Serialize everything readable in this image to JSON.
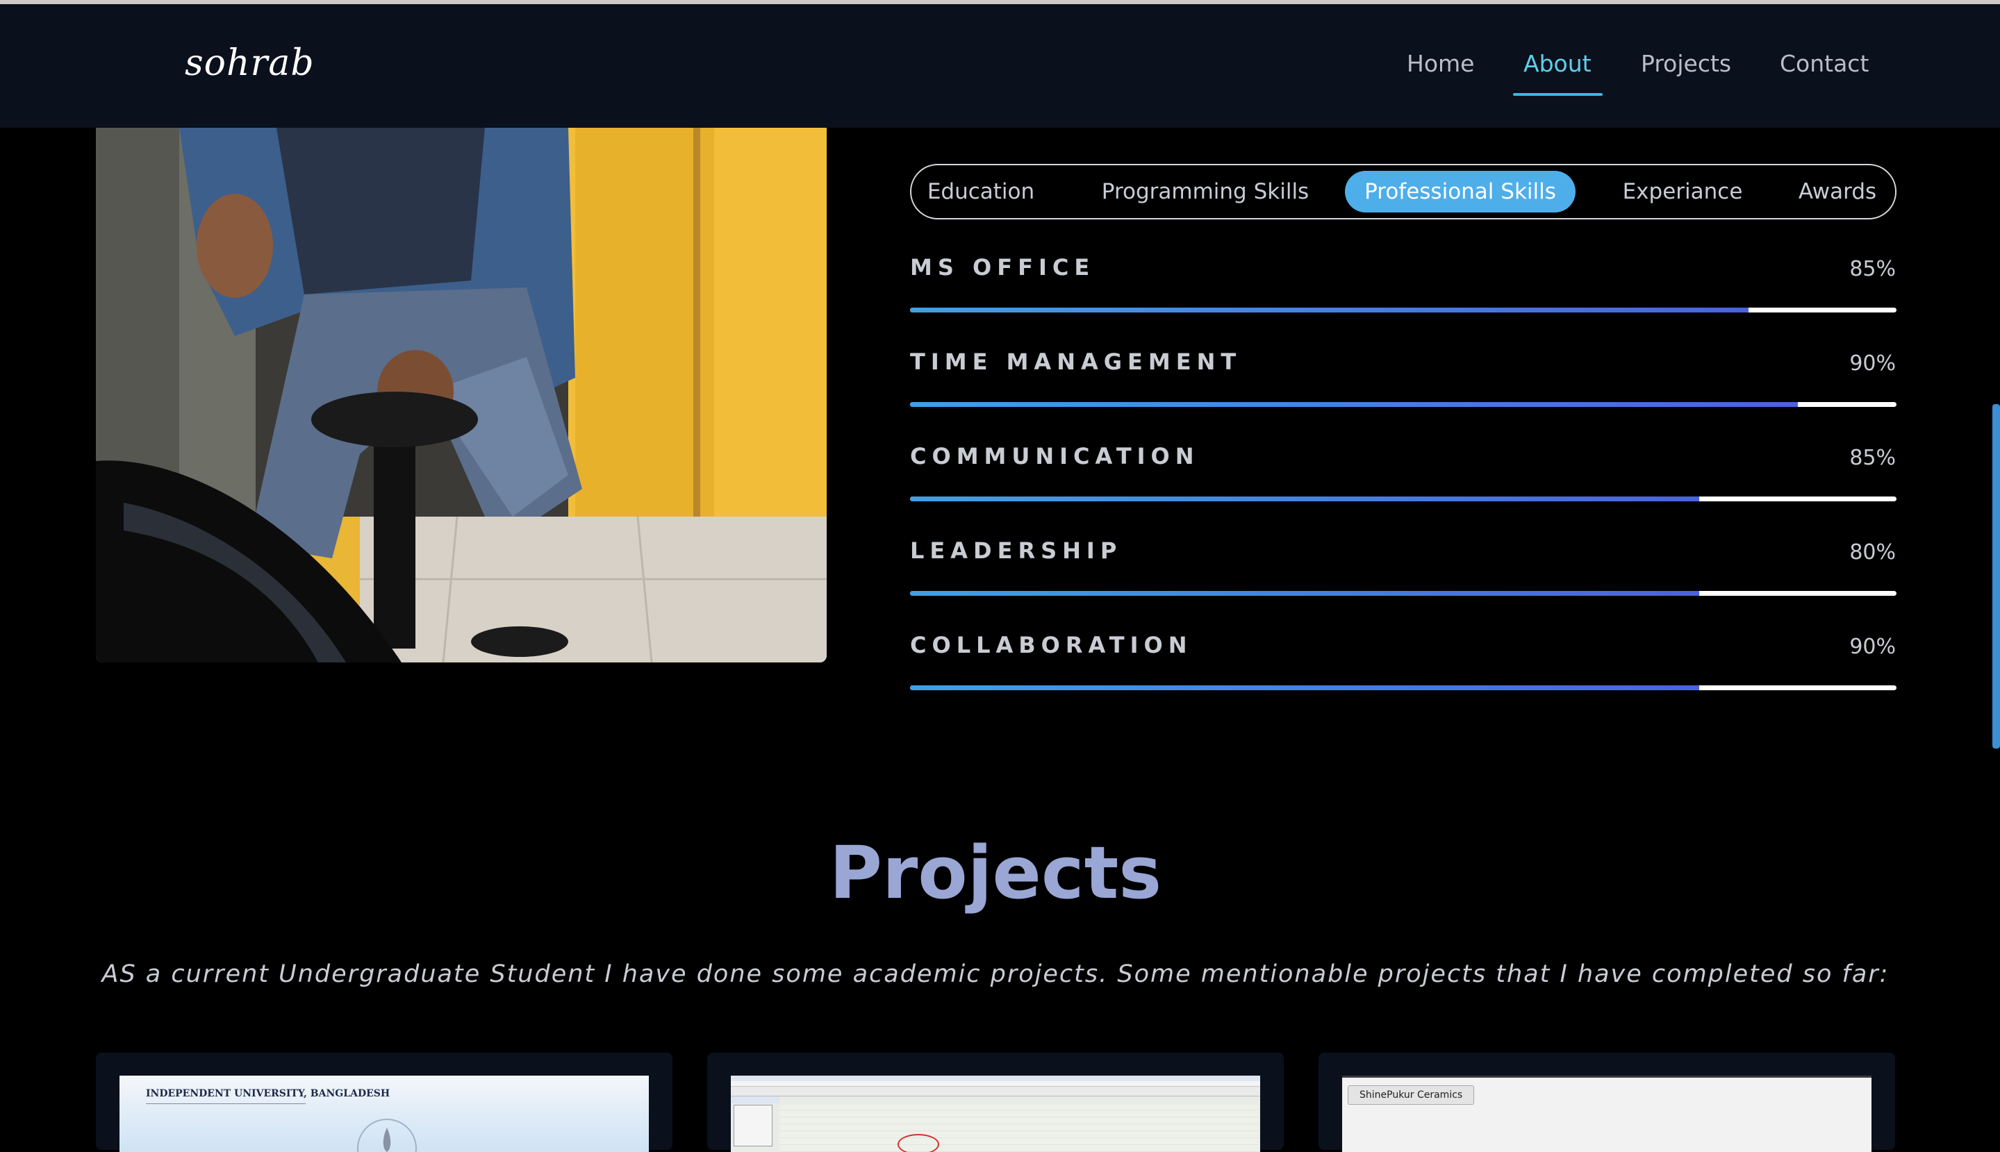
{
  "navbar": {
    "logo": "sohrab",
    "items": [
      {
        "label": "Home",
        "active": false
      },
      {
        "label": "About",
        "active": true
      },
      {
        "label": "Projects",
        "active": false
      },
      {
        "label": "Contact",
        "active": false
      }
    ]
  },
  "skills_tabs": {
    "tabs": [
      {
        "label": "Education",
        "active": false
      },
      {
        "label": "Programming Skills",
        "active": false
      },
      {
        "label": "Professional Skills",
        "active": true
      },
      {
        "label": "Experiance",
        "active": false
      },
      {
        "label": "Awards",
        "active": false
      }
    ]
  },
  "skills": [
    {
      "name": "MS OFFICE",
      "percent_label": "85%",
      "fill": 0.85
    },
    {
      "name": "TIME MANAGEMENT",
      "percent_label": "90%",
      "fill": 0.9
    },
    {
      "name": "COMMUNICATION",
      "percent_label": "85%",
      "fill": 0.8
    },
    {
      "name": "LEADERSHIP",
      "percent_label": "80%",
      "fill": 0.8
    },
    {
      "name": "COLLABORATION",
      "percent_label": "90%",
      "fill": 0.8
    }
  ],
  "projects": {
    "title": "Projects",
    "subtitle": "AS a current Undergraduate Student I have done some academic projects. Some mentionable projects that I have completed so far:",
    "cards": [
      {
        "caption": "INDEPENDENT UNIVERSITY, BANGLADESH"
      },
      {
        "caption": ""
      },
      {
        "caption": "ShinePukur Ceramics"
      }
    ]
  },
  "colors": {
    "accent": "#4eaeea",
    "nav_active": "#5fd0ea",
    "projects_title": "#9aa6d4",
    "navbar_bg": "#0b101d"
  }
}
